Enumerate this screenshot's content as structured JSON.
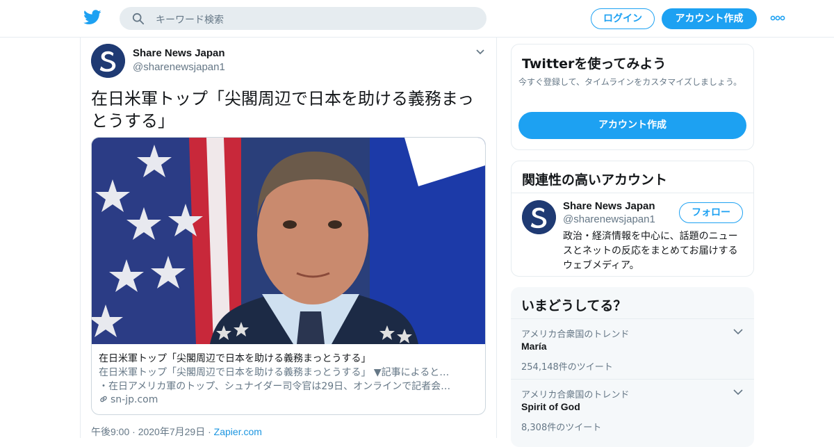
{
  "header": {
    "search_placeholder": "キーワード検索",
    "login_label": "ログイン",
    "signup_label": "アカウント作成",
    "brand_color": "#1da1f2"
  },
  "tweet": {
    "author_name": "Share News Japan",
    "author_handle": "@sharenewsjapan1",
    "text": "在日米軍トップ「尖閣周辺で日本を助ける義務まっとうする」",
    "card": {
      "title": "在日米軍トップ「尖閣周辺で日本を助ける義務まっとうする」",
      "description_line1": "在日米軍トップ「尖閣周辺で日本を助ける義務まっとうする」 ▼記事によると…",
      "description_line2": "・在日アメリカ軍のトップ、シュナイダー司令官は29日、オンラインで記者会…",
      "domain": "sn-jp.com"
    },
    "time": "午後9:00",
    "date": "2020年7月29日",
    "via": "Zapier.com"
  },
  "sidebar": {
    "signup_panel": {
      "title": "Twitterを使ってみよう",
      "subtitle": "今すぐ登録して、タイムラインをカスタマイズしましょう。",
      "button_label": "アカウント作成"
    },
    "relevant_panel": {
      "title": "関連性の高いアカウント",
      "name": "Share News Japan",
      "handle": "@sharenewsjapan1",
      "follow_label": "フォロー",
      "bio": "政治・経済情報を中心に、話題のニュースとネットの反応をまとめてお届けするウェブメディア。"
    },
    "trends_panel": {
      "title": "いまどうしてる？",
      "trends": [
        {
          "context": "アメリカ合衆国のトレンド",
          "name": "María",
          "count": "254,148件のツイート"
        },
        {
          "context": "アメリカ合衆国のトレンド",
          "name": "Spirit of God",
          "count": "8,308件のツイート"
        }
      ]
    }
  }
}
